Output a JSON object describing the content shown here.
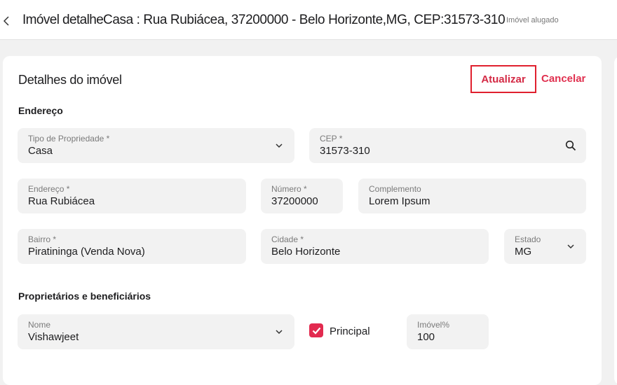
{
  "header": {
    "title": "Imóvel detalhe",
    "subtitle": "Casa : Rua Rubiácea, 37200000 - Belo Horizonte,MG, CEP:31573-310",
    "status": "Imóvel alugado"
  },
  "card": {
    "title": "Detalhes do imóvel",
    "update_label": "Atualizar",
    "cancel_label": "Cancelar"
  },
  "address": {
    "section_title": "Endereço",
    "tipo": {
      "label": "Tipo de Propriedade *",
      "value": "Casa"
    },
    "cep": {
      "label": "CEP *",
      "value": "31573-310"
    },
    "endereco": {
      "label": "Endereço *",
      "value": "Rua Rubiácea"
    },
    "numero": {
      "label": "Número *",
      "value": "37200000"
    },
    "complemento": {
      "label": "Complemento",
      "value": "Lorem Ipsum"
    },
    "bairro": {
      "label": "Bairro *",
      "value": "Piratininga (Venda Nova)"
    },
    "cidade": {
      "label": "Cidade *",
      "value": "Belo Horizonte"
    },
    "estado": {
      "label": "Estado",
      "value": "MG"
    }
  },
  "owners": {
    "section_title": "Proprietários e beneficiários",
    "nome": {
      "label": "Nome",
      "value": "Vishawjeet"
    },
    "principal_label": "Principal",
    "principal_checked": true,
    "percent": {
      "label": "Imóvel%",
      "value": "100"
    }
  },
  "icons": {
    "back": "chevron-left-icon",
    "dropdown": "chevron-down-icon",
    "search": "search-icon",
    "check": "check-icon"
  },
  "colors": {
    "accent": "#e22a4f",
    "update_border": "#e0202e",
    "field_bg": "#f2f2f2",
    "page_bg": "#f1f1f1"
  }
}
